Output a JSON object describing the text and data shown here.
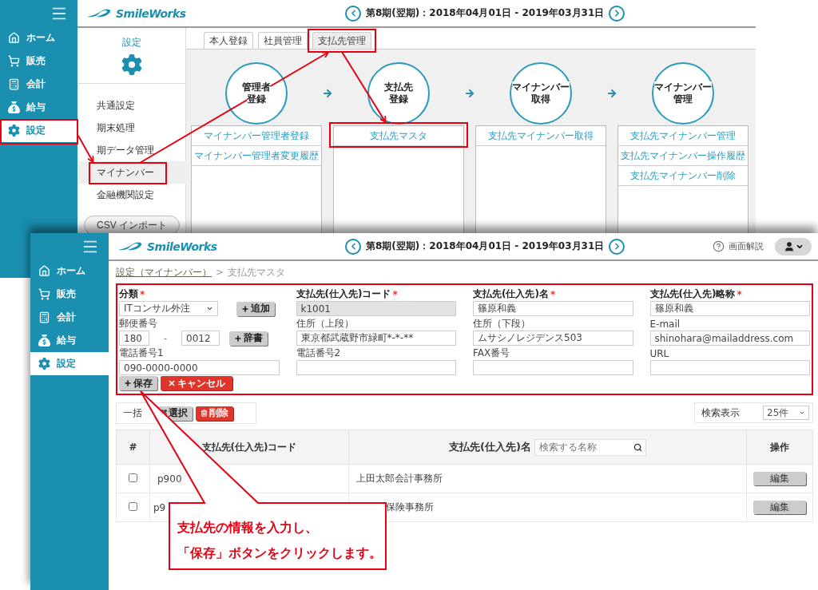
{
  "back_screen": {
    "sidebar": {
      "items": [
        {
          "kind": "home",
          "label": "ホーム",
          "selected": false
        },
        {
          "kind": "sales",
          "label": "販売",
          "selected": false
        },
        {
          "kind": "accounting",
          "label": "会計",
          "selected": false
        },
        {
          "kind": "payroll",
          "label": "給与",
          "selected": false
        },
        {
          "kind": "settings",
          "label": "設定",
          "selected": true
        }
      ]
    },
    "header": {
      "logo": "SmileWorks",
      "period": "第8期(翌期)：2018年04月01日 - 2019年03月31日"
    },
    "settings_panel": {
      "title": "設定",
      "menu": [
        {
          "label": "共通設定",
          "selected": false
        },
        {
          "label": "期末処理",
          "selected": false
        },
        {
          "label": "期データ管理",
          "selected": false
        },
        {
          "label": "マイナンバー",
          "selected": true
        },
        {
          "label": "金融機関設定",
          "selected": false
        }
      ],
      "csv_button": "CSV インポート"
    },
    "tabs": [
      {
        "label": "本人登録",
        "selected": false
      },
      {
        "label": "社員管理",
        "selected": false
      },
      {
        "label": "支払先管理",
        "selected": true
      }
    ],
    "flow": [
      {
        "title": [
          "管理者",
          "登録"
        ],
        "links": [
          "マイナンバー管理者登録",
          "マイナンバー管理者変更履歴"
        ]
      },
      {
        "title": [
          "支払先",
          "登録"
        ],
        "links": [
          "支払先マスタ"
        ]
      },
      {
        "title": [
          "マイナンバー",
          "取得"
        ],
        "links": [
          "支払先マイナンバー取得"
        ]
      },
      {
        "title": [
          "マイナンバー",
          "管理"
        ],
        "links": [
          "支払先マイナンバー管理",
          "支払先マイナンバー操作履歴",
          "支払先マイナンバー削除"
        ]
      }
    ]
  },
  "front_screen": {
    "sidebar": {
      "items": [
        {
          "kind": "home",
          "label": "ホーム",
          "selected": false
        },
        {
          "kind": "sales",
          "label": "販売",
          "selected": false
        },
        {
          "kind": "accounting",
          "label": "会計",
          "selected": false
        },
        {
          "kind": "payroll",
          "label": "給与",
          "selected": false
        },
        {
          "kind": "settings",
          "label": "設定",
          "selected": true
        }
      ]
    },
    "header": {
      "logo": "SmileWorks",
      "period": "第8期(翌期)：2018年04月01日 - 2019年03月31日",
      "help": "画面解説"
    },
    "breadcrumb": {
      "link": "設定（マイナンバー）",
      "separator": ">",
      "current": "支払先マスタ"
    },
    "form": {
      "fields": [
        {
          "kind": "select",
          "label": "分類",
          "required_mark": "*",
          "value": "ITコンサル外注",
          "button": "追加"
        },
        {
          "kind": "text",
          "label": "支払先(仕入先)コード",
          "required_mark": "*",
          "value": "k1001",
          "disabled": true
        },
        {
          "kind": "text",
          "label": "支払先(仕入先)名",
          "required_mark": "*",
          "value": "篠原和義",
          "disabled": false
        },
        {
          "kind": "text",
          "label": "支払先(仕入先)略称",
          "required_mark": "*",
          "value": "篠原和義",
          "disabled": false
        },
        {
          "kind": "zip",
          "label": "郵便番号",
          "values": [
            "180",
            "0012"
          ],
          "separator": "-",
          "button": "辞書"
        },
        {
          "kind": "text",
          "label": "住所（上段）",
          "value": "東京都武蔵野市緑町*-*-**",
          "disabled": false
        },
        {
          "kind": "text",
          "label": "住所（下段）",
          "value": "ムサシノレジデンス503",
          "disabled": false
        },
        {
          "kind": "text",
          "label": "E-mail",
          "value": "shinohara@mailaddress.com",
          "disabled": false
        },
        {
          "kind": "text",
          "label": "電話番号1",
          "value": "090-0000-0000",
          "disabled": false
        },
        {
          "kind": "text",
          "label": "電話番号2",
          "disabled": false
        },
        {
          "kind": "text",
          "label": "FAX番号",
          "disabled": false
        },
        {
          "kind": "text",
          "label": "URL",
          "disabled": false
        }
      ],
      "actions": [
        {
          "kind": "save",
          "label": "保存"
        },
        {
          "kind": "cancel",
          "label": "キャンセル"
        }
      ]
    },
    "bulk": {
      "label": "一括",
      "buttons": [
        {
          "kind": "select",
          "label": "選択"
        },
        {
          "kind": "delete",
          "label": "削除"
        }
      ]
    },
    "page_size": {
      "label": "検索表示",
      "value": "25件"
    },
    "table": {
      "columns": [
        "#",
        "支払先(仕入先)コード",
        "支払先(仕入先)名",
        "操作"
      ],
      "search_placeholder": "検索する名称",
      "rows": [
        {
          "checked": false,
          "code": "p900",
          "name": "上田太郎会計事務所",
          "action": "編集",
          "covered": false
        },
        {
          "checked": false,
          "code": "p9",
          "name": "保険事務所",
          "action": "編集",
          "covered": true
        }
      ]
    }
  },
  "callout": {
    "lines": [
      "支払先の情報を入力し、",
      "「保存」ボタンをクリックします。"
    ]
  }
}
